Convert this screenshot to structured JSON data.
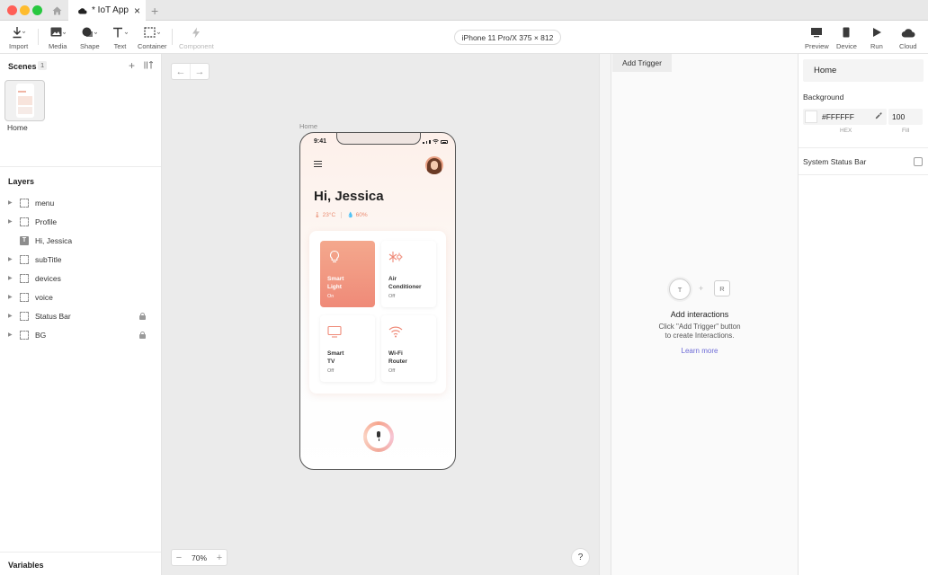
{
  "window": {
    "tab_title": "* IoT App",
    "tab_close": "×",
    "new_tab": "+",
    "colors": {
      "close": "#ff5f57",
      "minimize": "#febc2e",
      "zoom": "#28c840"
    }
  },
  "toolbar": {
    "import": "Import",
    "media": "Media",
    "shape": "Shape",
    "text": "Text",
    "container": "Container",
    "component": "Component",
    "device_select": "iPhone 11 Pro/X  375 × 812",
    "preview": "Preview",
    "device": "Device",
    "run": "Run",
    "cloud": "Cloud"
  },
  "scenes": {
    "title": "Scenes",
    "count": "1",
    "add": "+",
    "items": [
      {
        "label": "Home"
      }
    ]
  },
  "layers": {
    "title": "Layers",
    "items": [
      {
        "name": "menu",
        "locked": false
      },
      {
        "name": "Profile",
        "locked": false
      },
      {
        "name": "Hi, Jessica",
        "locked": false
      },
      {
        "name": "subTitle",
        "locked": false
      },
      {
        "name": "devices",
        "locked": false
      },
      {
        "name": "voice",
        "locked": false
      },
      {
        "name": "Status Bar",
        "locked": true
      },
      {
        "name": "BG",
        "locked": true
      }
    ]
  },
  "variables": {
    "title": "Variables"
  },
  "canvas": {
    "artboard_label": "Home",
    "zoom": "70%",
    "zoom_out": "−",
    "zoom_in": "+",
    "help": "?"
  },
  "phone": {
    "time": "9:41",
    "greeting": "Hi, Jessica",
    "temperature": "23°C",
    "humidity": "60%",
    "devices": [
      {
        "name": "Smart\nLight",
        "state": "On",
        "icon": "lightbulb-icon"
      },
      {
        "name": "Air\nConditioner",
        "state": "Off",
        "icon": "snowflake-sun-icon"
      },
      {
        "name": "Smart\nTV",
        "state": "Off",
        "icon": "tv-icon"
      },
      {
        "name": "Wi-Fi\nRouter",
        "state": "Off",
        "icon": "wifi-icon"
      }
    ],
    "accent": "#ef8a78"
  },
  "interactions": {
    "add_trigger": "Add Trigger",
    "trigger_badge": "T",
    "plus": "+",
    "response_badge": "R",
    "title": "Add interactions",
    "desc_line1": "Click \"Add Trigger\" button",
    "desc_line2": "to create Interactions.",
    "learn_more": "Learn more"
  },
  "properties": {
    "scene_name": "Home",
    "background_label": "Background",
    "hex_value": "#FFFFFF",
    "hex_label": "HEX",
    "fill_value": "100",
    "fill_label": "Fill",
    "status_bar_label": "System Status Bar"
  }
}
